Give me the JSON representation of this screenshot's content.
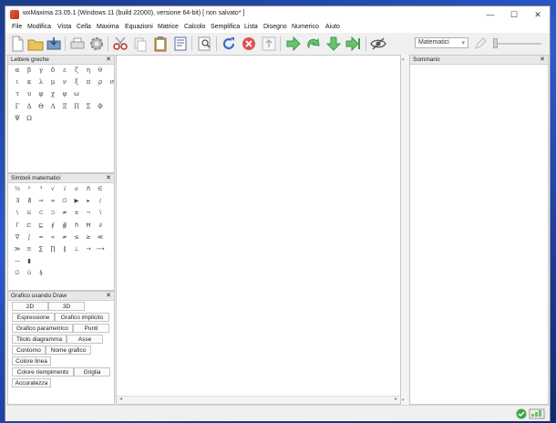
{
  "window": {
    "title": "wxMaxima 23.05.1 (Windows 11 (build 22000), versione 64-bit) [ non salvato* ]",
    "minimize": "—",
    "maximize": "☐",
    "close": "✕"
  },
  "menu": [
    "File",
    "Modifica",
    "Vista",
    "Cella",
    "Maxima",
    "Equazioni",
    "Matrice",
    "Calcolo",
    "Semplifica",
    "Lista",
    "Disegno",
    "Numerico",
    "Aiuto"
  ],
  "toolbar": {
    "mode_select": "Matematici",
    "mode_arrow": "▾"
  },
  "greek_pane": {
    "title": "Lettere greche",
    "close": "✕",
    "rows": [
      [
        "α",
        "β",
        "γ",
        "δ",
        "ε",
        "ζ",
        "η",
        "θ"
      ],
      [
        "ι",
        "κ",
        "λ",
        "μ",
        "ν",
        "ξ",
        "π",
        "ρ",
        "σ"
      ],
      [
        "τ",
        "υ",
        "φ",
        "χ",
        "ψ",
        "ω"
      ],
      [
        "Γ",
        "Δ",
        "Θ",
        "Λ",
        "Ξ",
        "Π",
        "Σ",
        "Φ"
      ],
      [
        "Ψ",
        "Ω"
      ]
    ]
  },
  "math_pane": {
    "title": "Simboli matematici",
    "close": "✕",
    "rows": [
      [
        "½",
        "²",
        "³",
        "√",
        "ⅈ",
        "ⅇ",
        "ℏ",
        "∈"
      ],
      [
        "∃",
        "∄",
        "⇒",
        "∞",
        "∅",
        "▶",
        "▸",
        "/"
      ],
      [
        "\\",
        "⊆",
        "⊂",
        "⊃",
        "≠",
        "±",
        "¬",
        "∖"
      ],
      [
        "Γ",
        "⊏",
        "⊑",
        "∮",
        "∯",
        "ℏ",
        "Ħ",
        "∂"
      ],
      [
        "∇",
        "∫",
        "≈",
        "∝",
        "≠",
        "≤",
        "≥",
        "≪"
      ],
      [
        "≫",
        "≡",
        "∑",
        "∏",
        "∥",
        "⊥",
        "→",
        "⟶"
      ],
      [
        "—",
        "▮"
      ],
      [
        "∅",
        "ü",
        "§"
      ]
    ]
  },
  "draw_pane": {
    "title": "Grafico usando Draw",
    "close": "✕",
    "buttons": {
      "b2d": "2D",
      "b3d": "3D",
      "espressione": "Espressione",
      "grafico_implicito": "Grafico implicito",
      "grafico_parametrico": "Grafico parametrico",
      "punti": "Punti",
      "titolo_diagramma": "Titolo diagramma",
      "asse": "Asse",
      "contorno": "Contorno",
      "nome_grafico": "Nome grafico",
      "colore_linea": "Colore linea",
      "colore_riempimento": "Colore riempimento",
      "griglia": "Griglia",
      "accuratezza": "Accuratezza"
    }
  },
  "summary_pane": {
    "title": "Sommario",
    "close": "✕"
  },
  "scroll": {
    "left": "◂",
    "right": "▸",
    "up": "▴",
    "down": "▾"
  }
}
